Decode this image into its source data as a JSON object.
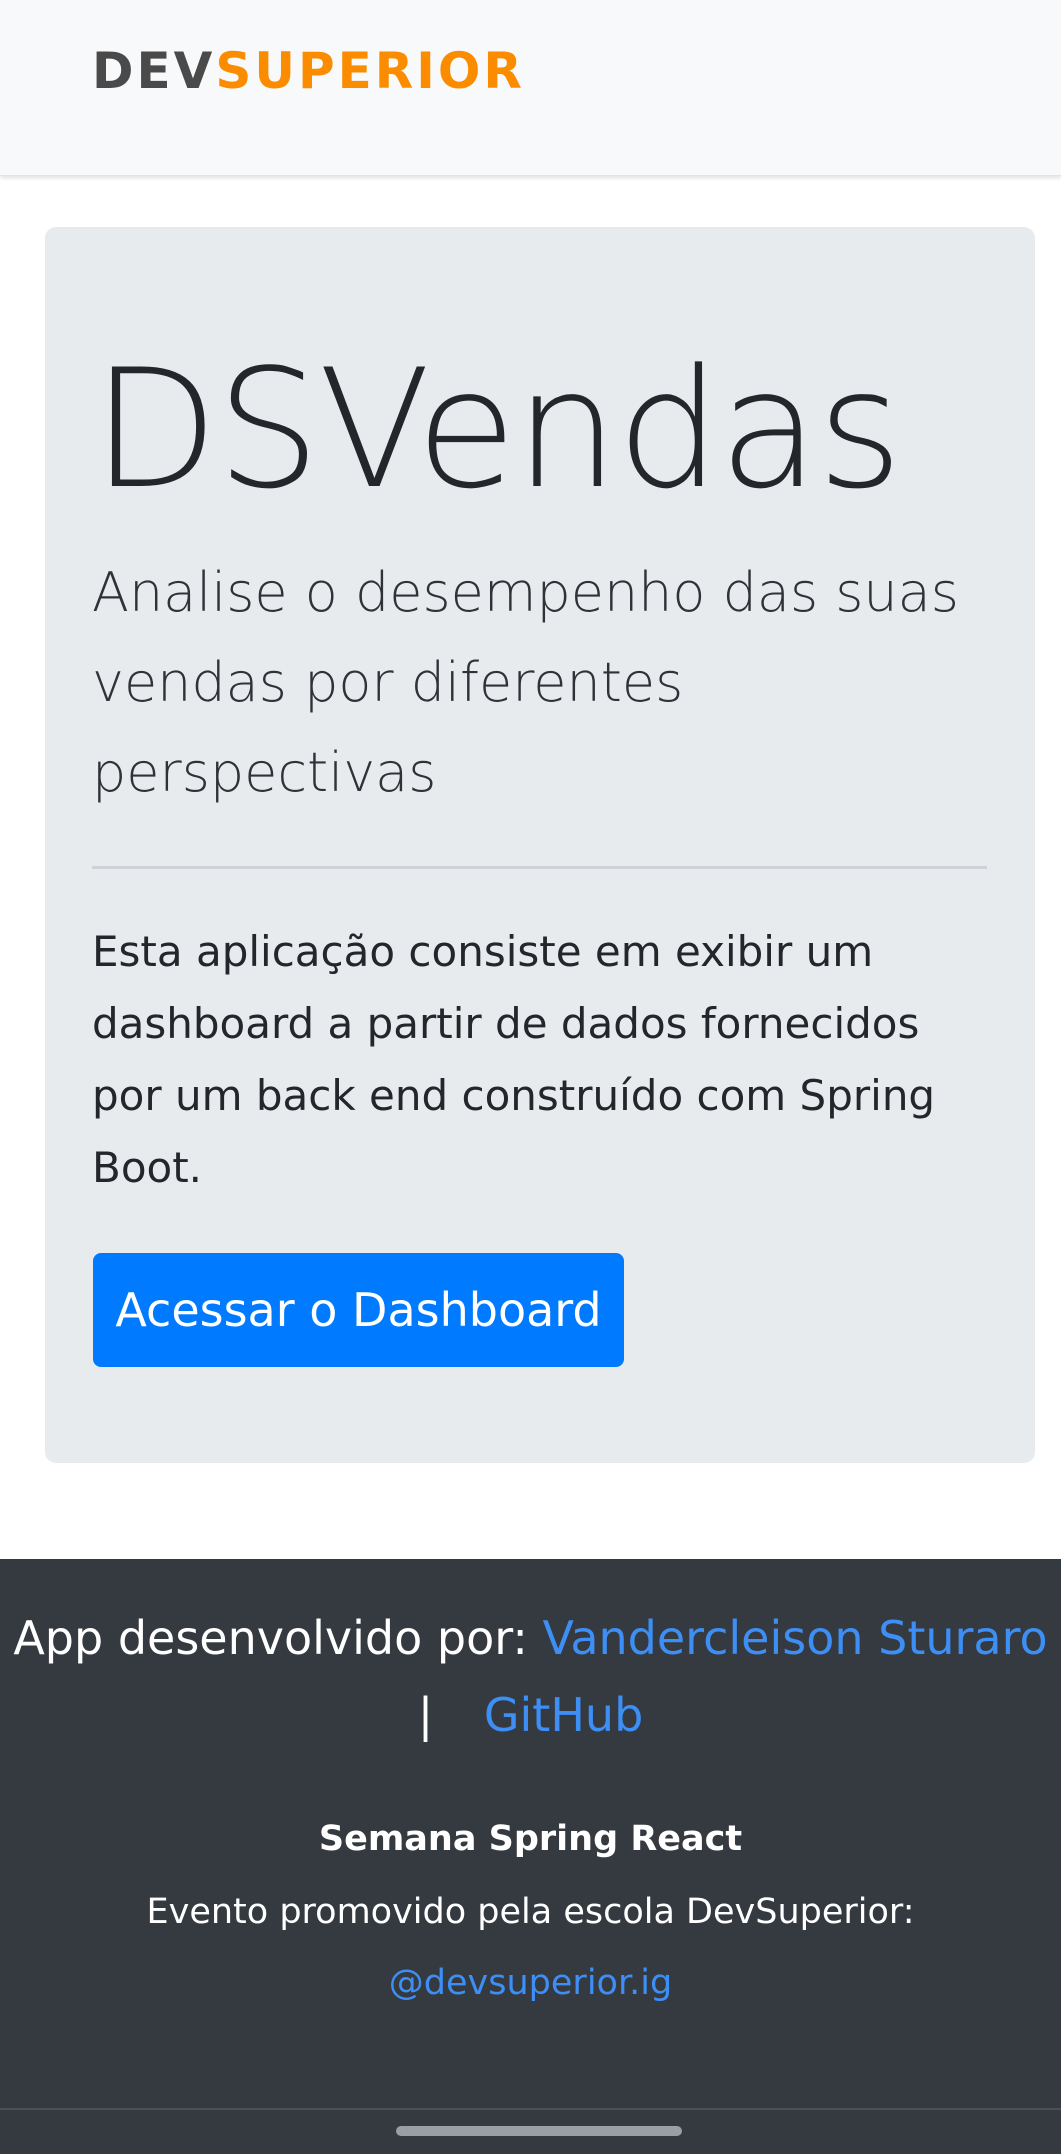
{
  "header": {
    "logo_part1": "DEV",
    "logo_part2": "SUPERIOR",
    "colors": {
      "logo_dark": "#4a4a4a",
      "logo_orange": "#fb8c00"
    }
  },
  "jumbotron": {
    "title": "DSVendas",
    "lead": "Analise o desempenho das suas vendas por diferentes perspectivas",
    "description": "Esta aplicação consiste em exibir um dashboard a partir de dados fornecidos por um back end construído com Spring Boot.",
    "button_label": "Acessar o Dashboard",
    "colors": {
      "background": "#e8ebee",
      "button": "#007bff"
    }
  },
  "footer": {
    "credit_prefix": "App desenvolvido por:",
    "author_link": "Vandercleison Sturaro",
    "separator": "|",
    "github_link": "GitHub",
    "event_title": "Semana Spring React",
    "event_desc": "Evento promovido pela escola DevSuperior:",
    "instagram_link": "@devsuperior.ig",
    "colors": {
      "background": "#343a40",
      "link": "#3d8ef5"
    }
  }
}
